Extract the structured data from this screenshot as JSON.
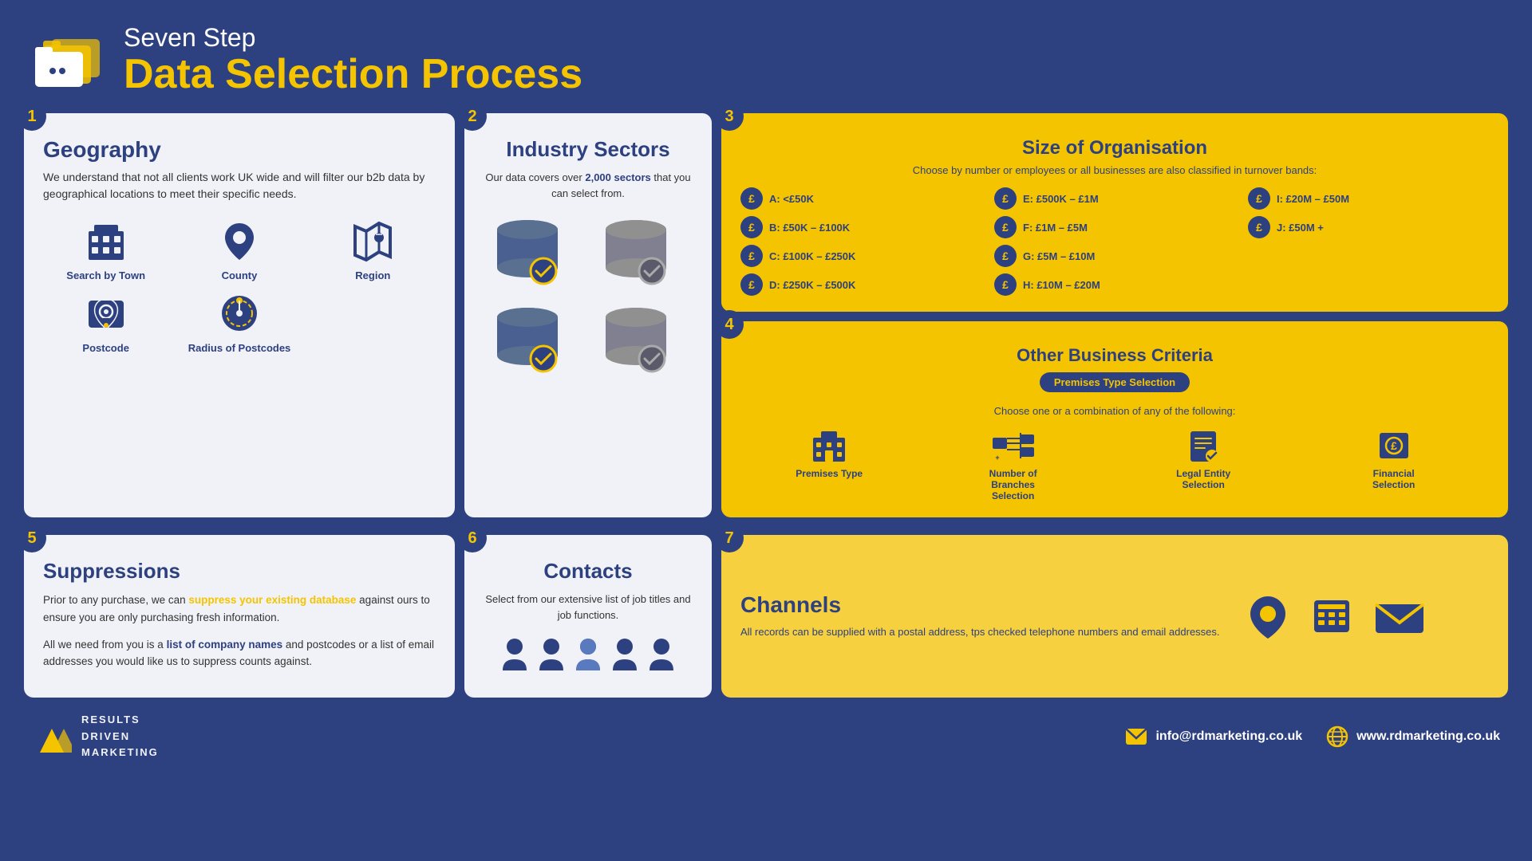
{
  "header": {
    "subtitle": "Seven Step",
    "title": "Data Selection Process"
  },
  "step1": {
    "step": "1",
    "title": "Geography",
    "description": "We understand that not all clients work UK wide and will filter our b2b data by geographical locations to meet their specific needs.",
    "items": [
      {
        "label": "Search by Town"
      },
      {
        "label": "County"
      },
      {
        "label": "Region"
      },
      {
        "label": "Postcode"
      },
      {
        "label": "Radius of Postcodes"
      }
    ]
  },
  "step2": {
    "step": "2",
    "title": "Industry Sectors",
    "description": "Our data covers over 2,000 sectors that you can select from.",
    "highlight": "2,000"
  },
  "step3": {
    "step": "3",
    "title": "Size of Organisation",
    "description": "Choose by number or employees or all businesses are also classified in turnover bands:",
    "bands": [
      {
        "label": "A: <£50K"
      },
      {
        "label": "E: £500K – £1M"
      },
      {
        "label": "I: £20M – £50M"
      },
      {
        "label": "B: £50K – £100K"
      },
      {
        "label": "F: £1M – £5M"
      },
      {
        "label": "J: £50M +"
      },
      {
        "label": "C: £100K – £250K"
      },
      {
        "label": "G: £5M – £10M"
      },
      {
        "label": ""
      },
      {
        "label": "D: £250K – £500K"
      },
      {
        "label": "H: £10M – £20M"
      },
      {
        "label": ""
      }
    ]
  },
  "step4": {
    "step": "4",
    "title": "Other Business Criteria",
    "badge": "Premises Type Selection",
    "description": "Choose one or a combination of any of the following:",
    "items": [
      {
        "label": "Premises Type"
      },
      {
        "label": "Number of Branches Selection"
      },
      {
        "label": "Legal Entity Selection"
      },
      {
        "label": "Financial Selection"
      }
    ]
  },
  "step5": {
    "step": "5",
    "title": "Suppressions",
    "para1": "Prior to any purchase, we can suppress your existing database against ours to ensure you are only purchasing fresh information.",
    "highlight": "suppress your existing database",
    "para2_before": "All we need from you is a ",
    "para2_link": "list of company names",
    "para2_after": " and postcodes or a list of email addresses you would like us to suppress counts against."
  },
  "step6": {
    "step": "6",
    "title": "Contacts",
    "description": "Select from our extensive list of job titles and job functions."
  },
  "step7": {
    "step": "7",
    "title": "Channels",
    "description": "All records can be supplied with a postal address, tps checked telephone numbers and email addresses."
  },
  "footer": {
    "logo_lines": [
      "RESULTS",
      "DRIVEN",
      "MARKETING"
    ],
    "email": "info@rdmarketing.co.uk",
    "website": "www.rdmarketing.co.uk"
  }
}
